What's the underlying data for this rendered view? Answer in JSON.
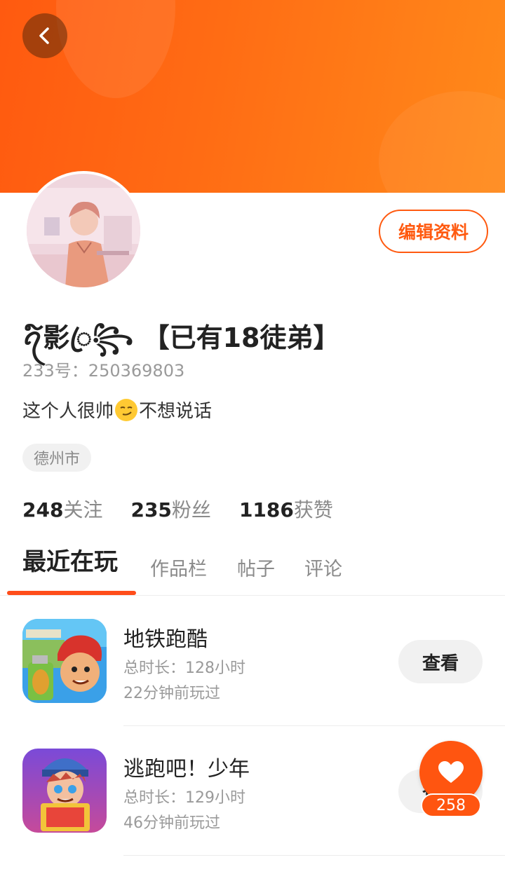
{
  "header": {
    "back_icon": "chevron-left-icon"
  },
  "profile": {
    "nickname": "ꪖ໌影ꦿ꧂ 【已有18徒弟】",
    "uid": "233号：250369803",
    "bio_before": "这个人很帅",
    "bio_emoji": "smirk-emoji-icon",
    "bio_after": "不想说话",
    "location": "德州市",
    "edit_label": "编辑资料"
  },
  "stats": [
    {
      "num": "248",
      "label": "关注"
    },
    {
      "num": "235",
      "label": "粉丝"
    },
    {
      "num": "1186",
      "label": "获赞"
    }
  ],
  "tabs": [
    {
      "label": "最近在玩",
      "active": true
    },
    {
      "label": "作品栏",
      "active": false
    },
    {
      "label": "帖子",
      "active": false
    },
    {
      "label": "评论",
      "active": false
    }
  ],
  "games": [
    {
      "title": "地铁跑酷",
      "duration": "总时长：128小时",
      "last_played": "22分钟前玩过",
      "action": "查看"
    },
    {
      "title": "逃跑吧！少年",
      "duration": "总时长：129小时",
      "last_played": "46分钟前玩过",
      "action": "查看"
    }
  ],
  "like": {
    "icon": "heart-icon",
    "count": "258"
  },
  "colors": {
    "accent": "#ff5a10",
    "banner_end": "#ff8a1a"
  }
}
